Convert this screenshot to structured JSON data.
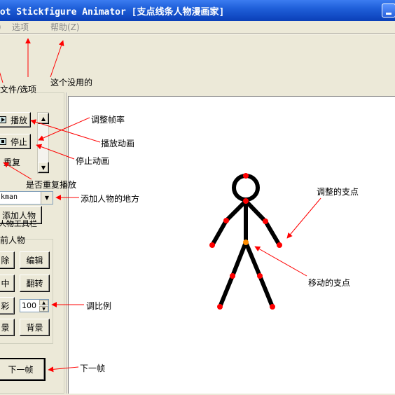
{
  "window": {
    "title": "vot Stickfigure Animator [支点线条人物漫画家]"
  },
  "menu": {
    "items": [
      "）",
      "选项",
      "帮助(Z)"
    ],
    "item_file_partial": "）",
    "item_options": "选项",
    "item_help": "帮助(Z)"
  },
  "annotations": {
    "file_options": "文件/选项",
    "useless": "这个没用的",
    "adjust_fps": "调整帧率",
    "play_animation": "播放动画",
    "stop_animation": "停止动画",
    "repeat_toggle": "是否重复播放",
    "add_figure_place": "添加人物的地方",
    "adjust_pivot": "调整的支点",
    "move_pivot": "移动的支点",
    "scale": "调比例",
    "next_frame": "下一帧"
  },
  "controls": {
    "play_label": "播放",
    "stop_label": "停止",
    "repeat_label": "重复",
    "figure_select_value": "kman",
    "add_figure_label": "添加人物",
    "figure_toolbar_label": "人物工具栏",
    "current_figure_group": "前人物",
    "delete_label": "除",
    "edit_label": "编辑",
    "center_label": "中",
    "flip_label": "翻转",
    "color_label": "彩",
    "scale_value": "100",
    "fg_label": "景",
    "background_label": "背景",
    "next_frame_label": "下一帧"
  },
  "colors": {
    "arrow": "#ff0000",
    "pivot_normal": "#ff0000",
    "pivot_origin": "#ff8c00",
    "figure": "#000000",
    "titlebar": "#1f5fd9"
  }
}
